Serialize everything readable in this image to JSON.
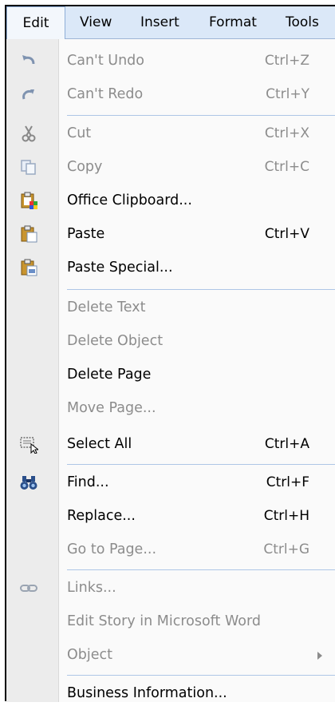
{
  "menubar": {
    "items": [
      "Edit",
      "View",
      "Insert",
      "Format",
      "Tools"
    ]
  },
  "menu": {
    "items": [
      {
        "label": "Can't Undo",
        "shortcut": "Ctrl+Z",
        "icon": "undo-icon",
        "enabled": false
      },
      {
        "label": "Can't Redo",
        "shortcut": "Ctrl+Y",
        "icon": "redo-icon",
        "enabled": false
      },
      {
        "label": "Cut",
        "shortcut": "Ctrl+X",
        "icon": "scissors-icon",
        "enabled": false
      },
      {
        "label": "Copy",
        "shortcut": "Ctrl+C",
        "icon": "copy-icon",
        "enabled": false
      },
      {
        "label": "Office Clipboard...",
        "shortcut": "",
        "icon": "office-clipboard-icon",
        "enabled": true
      },
      {
        "label": "Paste",
        "shortcut": "Ctrl+V",
        "icon": "paste-icon",
        "enabled": true
      },
      {
        "label": "Paste Special...",
        "shortcut": "",
        "icon": "paste-special-icon",
        "enabled": true
      },
      {
        "label": "Delete Text",
        "shortcut": "",
        "icon": "",
        "enabled": false
      },
      {
        "label": "Delete Object",
        "shortcut": "",
        "icon": "",
        "enabled": false
      },
      {
        "label": "Delete Page",
        "shortcut": "",
        "icon": "",
        "enabled": true
      },
      {
        "label": "Move Page...",
        "shortcut": "",
        "icon": "",
        "enabled": false
      },
      {
        "label": "Select All",
        "shortcut": "Ctrl+A",
        "icon": "select-all-icon",
        "enabled": true
      },
      {
        "label": "Find...",
        "shortcut": "Ctrl+F",
        "icon": "binoculars-icon",
        "enabled": true
      },
      {
        "label": "Replace...",
        "shortcut": "Ctrl+H",
        "icon": "",
        "enabled": true
      },
      {
        "label": "Go to Page...",
        "shortcut": "Ctrl+G",
        "icon": "",
        "enabled": false
      },
      {
        "label": "Links...",
        "shortcut": "",
        "icon": "chain-link-icon",
        "enabled": false
      },
      {
        "label": "Edit Story in Microsoft Word",
        "shortcut": "",
        "icon": "",
        "enabled": false
      },
      {
        "label": "Object",
        "shortcut": "",
        "icon": "",
        "enabled": false
      },
      {
        "label": "Business Information...",
        "shortcut": "",
        "icon": "",
        "enabled": true
      }
    ]
  }
}
